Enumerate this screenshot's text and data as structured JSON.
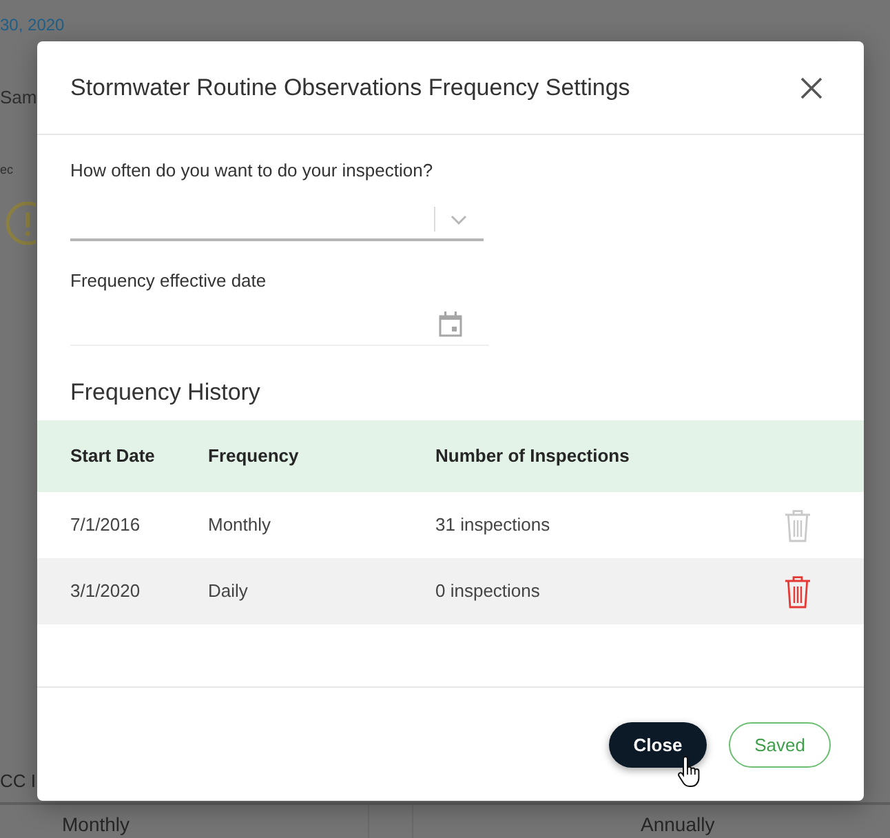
{
  "background_page": {
    "date_text": "30, 2020",
    "heading_fragment": "Sam",
    "label_fragment": "ec",
    "section_fragment": "CC I",
    "table_cells": [
      "Monthly",
      "Annually"
    ]
  },
  "dialog": {
    "title": "Stormwater Routine Observations Frequency Settings",
    "fields": [
      {
        "kind": "select",
        "label": "How often do you want to do your inspection?"
      },
      {
        "kind": "date",
        "label": "Frequency effective date"
      }
    ],
    "history": {
      "title": "Frequency History",
      "columns": [
        "Start Date",
        "Frequency",
        "Number of Inspections"
      ],
      "rows": [
        {
          "start_date": "7/1/2016",
          "frequency": "Monthly",
          "inspections": "31 inspections",
          "highlighted": false
        },
        {
          "start_date": "3/1/2020",
          "frequency": "Daily",
          "inspections": "0 inspections",
          "highlighted": true
        }
      ]
    },
    "buttons": [
      {
        "label": "Close",
        "kind": "primary"
      },
      {
        "label": "Saved",
        "kind": "outline"
      }
    ]
  }
}
